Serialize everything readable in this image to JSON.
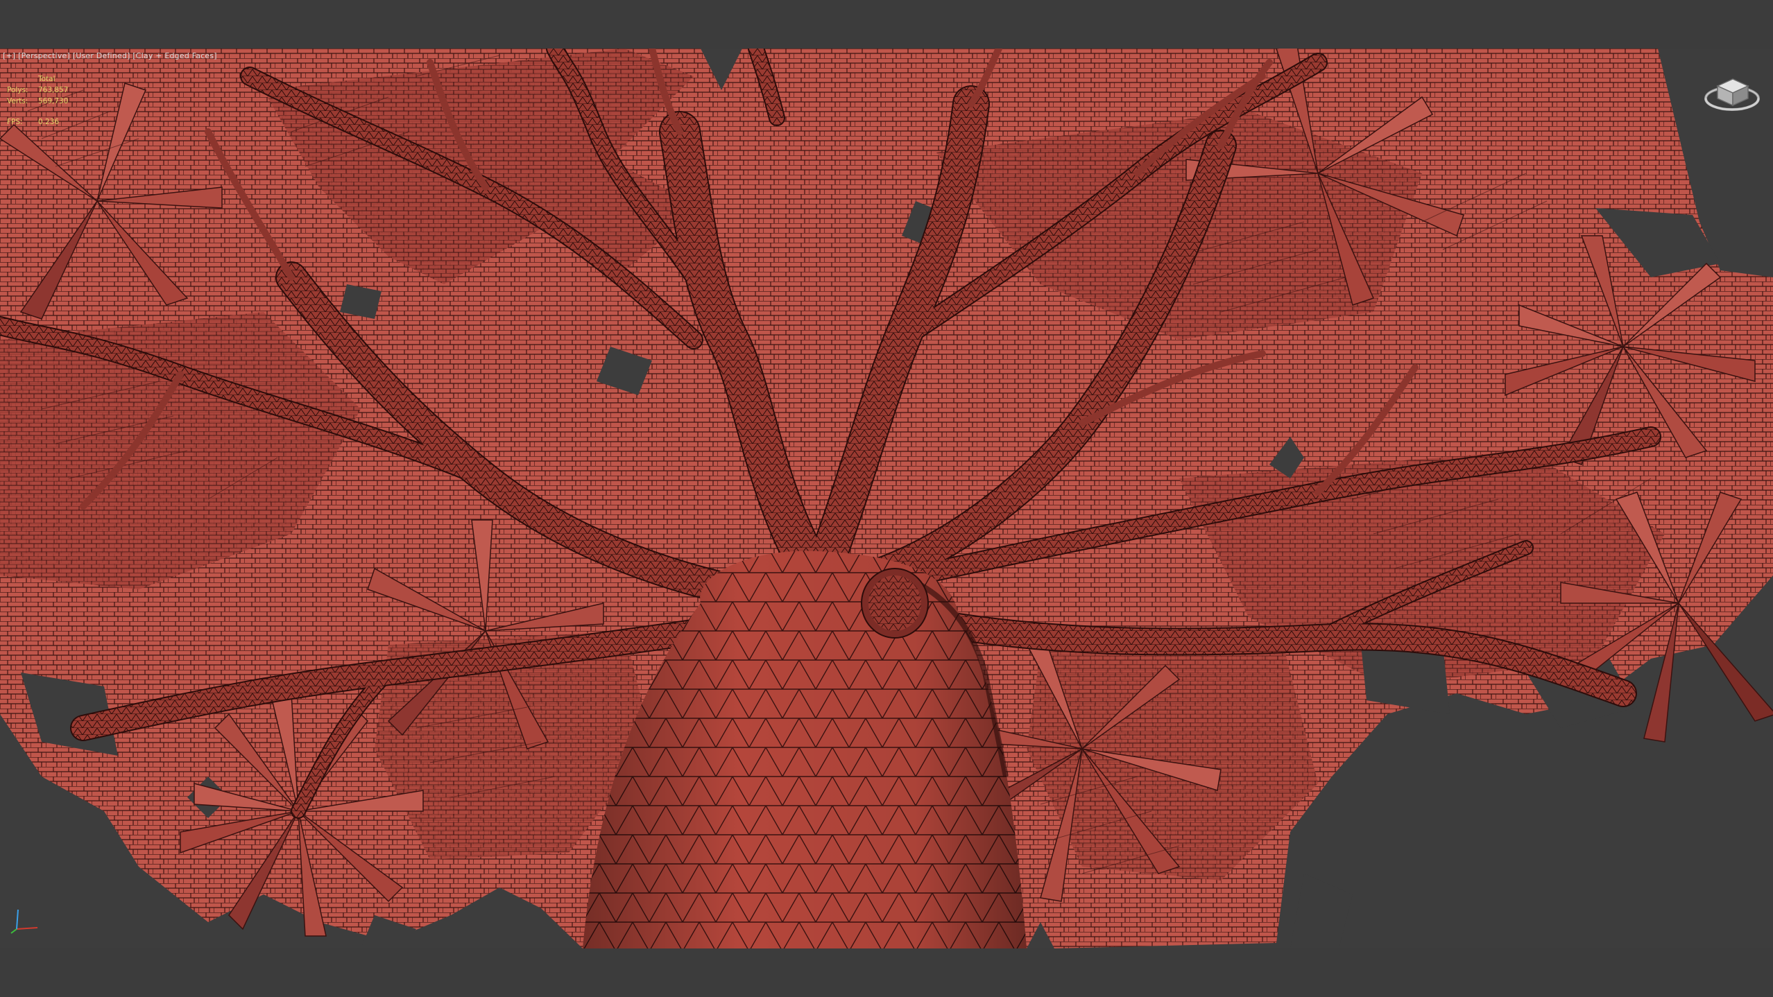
{
  "viewport": {
    "label_plus": "[+]",
    "label_view": "[Perspective]",
    "label_shading": "[User Defined]",
    "label_mode": "[Clay + Edged Faces]"
  },
  "stats": {
    "total_label": "Total",
    "polys_label": "Polys:",
    "polys_value": "763,857",
    "verts_label": "Verts:",
    "verts_value": "569,730",
    "fps_label": "FPS:",
    "fps_value": "0.236"
  },
  "icons": {
    "viewcube": "viewcube-icon",
    "axis": "axis-tripod-icon"
  },
  "colors": {
    "background": "#3c3c3c",
    "clay": "#b8483d",
    "clay_dark": "#5e1c18",
    "wire": "#2a0d0b",
    "stats_text": "#e6d36a"
  }
}
